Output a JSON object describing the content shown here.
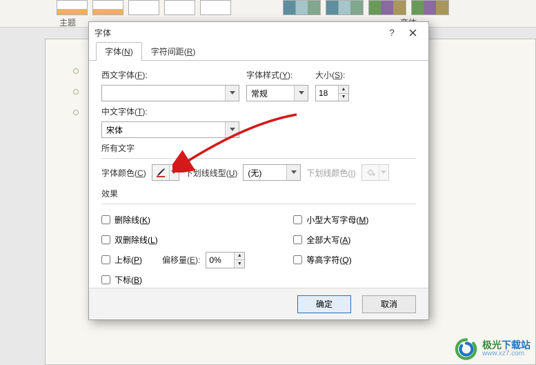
{
  "ribbon": {
    "theme_label": "主题",
    "variant_label": "变体"
  },
  "dialog": {
    "title": "字体",
    "tabs": {
      "font": {
        "label": "字体",
        "key": "N"
      },
      "spacing": {
        "label": "字符间距",
        "key": "R"
      }
    },
    "labels": {
      "latin_font": "西文字体",
      "latin_font_key": "F",
      "font_style": "字体样式",
      "font_style_key": "Y",
      "size": "大小",
      "size_key": "S",
      "asian_font": "中文字体",
      "asian_font_key": "T",
      "all_text": "所有文字",
      "font_color": "字体颜色",
      "font_color_key": "C",
      "underline_style": "下划线线型",
      "underline_style_key": "U",
      "underline_color": "下划线颜色",
      "underline_color_key": "I",
      "effects": "效果",
      "offset": "偏移量",
      "offset_key": "E"
    },
    "values": {
      "latin_font": "",
      "font_style": "常规",
      "size": "18",
      "asian_font": "宋体",
      "underline_style": "(无)",
      "offset": "0%"
    },
    "effects_list": {
      "strike": {
        "label": "删除线",
        "key": "K",
        "checked": false
      },
      "dstrike": {
        "label": "双删除线",
        "key": "L",
        "checked": false
      },
      "superscript": {
        "label": "上标",
        "key": "P",
        "checked": false
      },
      "subscript": {
        "label": "下标",
        "key": "B",
        "checked": false
      },
      "smallcaps": {
        "label": "小型大写字母",
        "key": "M",
        "checked": false
      },
      "allcaps": {
        "label": "全部大写",
        "key": "A",
        "checked": false
      },
      "equalize": {
        "label": "等高字符",
        "key": "Q",
        "checked": false
      }
    },
    "buttons": {
      "ok": "确定",
      "cancel": "取消"
    }
  },
  "watermark": {
    "name_part1": "极光",
    "name_part2": "下载站",
    "url": "www.xz7.com"
  }
}
